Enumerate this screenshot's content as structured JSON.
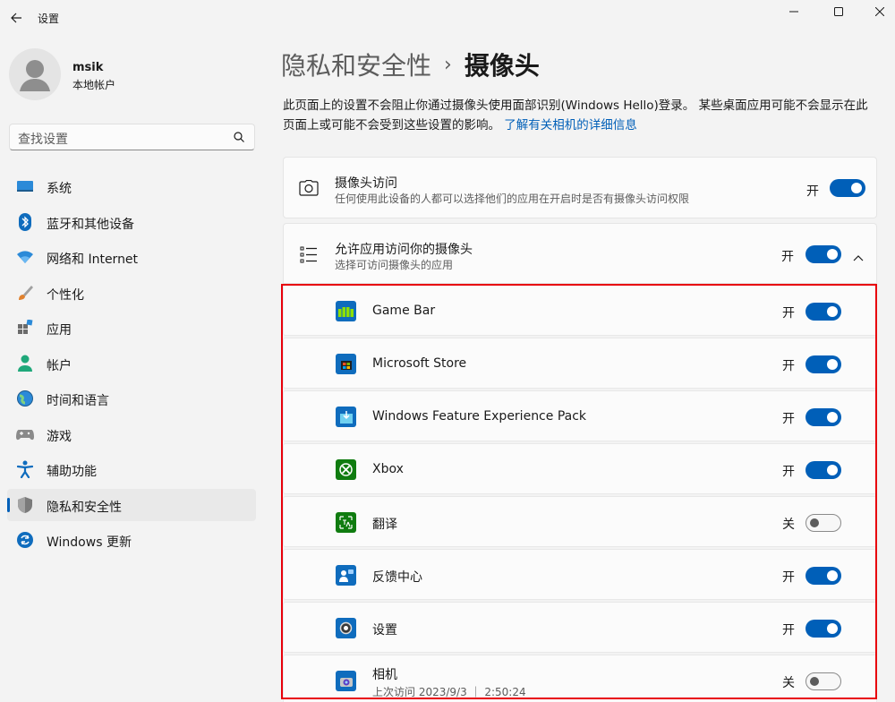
{
  "window": {
    "app_title": "设置",
    "back_icon": "back-arrow-icon",
    "controls": [
      "minimize-icon",
      "maximize-icon",
      "close-icon"
    ]
  },
  "profile": {
    "name": "msik",
    "account_type": "本地帐户"
  },
  "search": {
    "placeholder": "查找设置"
  },
  "sidebar": {
    "items": [
      {
        "label": "系统",
        "icon": "system-icon"
      },
      {
        "label": "蓝牙和其他设备",
        "icon": "bluetooth-icon"
      },
      {
        "label": "网络和 Internet",
        "icon": "network-icon"
      },
      {
        "label": "个性化",
        "icon": "brush-icon"
      },
      {
        "label": "应用",
        "icon": "apps-icon"
      },
      {
        "label": "帐户",
        "icon": "account-icon"
      },
      {
        "label": "时间和语言",
        "icon": "globe-icon"
      },
      {
        "label": "游戏",
        "icon": "gamepad-icon"
      },
      {
        "label": "辅助功能",
        "icon": "accessibility-icon"
      },
      {
        "label": "隐私和安全性",
        "icon": "shield-icon",
        "active": true
      },
      {
        "label": "Windows 更新",
        "icon": "update-icon"
      }
    ]
  },
  "header": {
    "parent": "隐私和安全性",
    "separator": "›",
    "current": "摄像头"
  },
  "description": {
    "text": "此页面上的设置不会阻止你通过摄像头使用面部识别(Windows Hello)登录。 某些桌面应用可能不会显示在此页面上或可能不会受到这些设置的影响。 ",
    "link": "了解有关相机的详细信息"
  },
  "camera_access": {
    "title": "摄像头访问",
    "subtitle": "任何使用此设备的人都可以选择他们的应用在开启时是否有摄像头访问权限",
    "state": "开",
    "on": true,
    "icon": "camera-icon"
  },
  "app_access": {
    "title": "允许应用访问你的摄像头",
    "subtitle": "选择可访问摄像头的应用",
    "state": "开",
    "on": true,
    "icon": "list-icon"
  },
  "apps": [
    {
      "name": "Game Bar",
      "state": "开",
      "on": true,
      "icon": "game-bar-icon",
      "color": "#0f6cbd"
    },
    {
      "name": "Microsoft Store",
      "state": "开",
      "on": true,
      "icon": "store-icon",
      "color": "#0f6cbd"
    },
    {
      "name": "Windows Feature Experience Pack",
      "state": "开",
      "on": true,
      "icon": "feature-pack-icon",
      "color": "#0f6cbd"
    },
    {
      "name": "Xbox",
      "state": "开",
      "on": true,
      "icon": "xbox-icon",
      "color": "#107c10"
    },
    {
      "name": "翻译",
      "state": "关",
      "on": false,
      "icon": "translate-icon",
      "color": "#107c10"
    },
    {
      "name": "反馈中心",
      "state": "开",
      "on": true,
      "icon": "feedback-icon",
      "color": "#0f6cbd"
    },
    {
      "name": "设置",
      "state": "开",
      "on": true,
      "icon": "settings-gear-icon",
      "color": "#0f6cbd"
    },
    {
      "name": "相机",
      "subtitle": "上次访问 2023/9/3 ｜ 2:50:24",
      "state": "关",
      "on": false,
      "icon": "camera-app-icon",
      "color": "#0f6cbd"
    }
  ],
  "colors": {
    "accent": "#005fb8",
    "highlight": "#e8000b"
  }
}
